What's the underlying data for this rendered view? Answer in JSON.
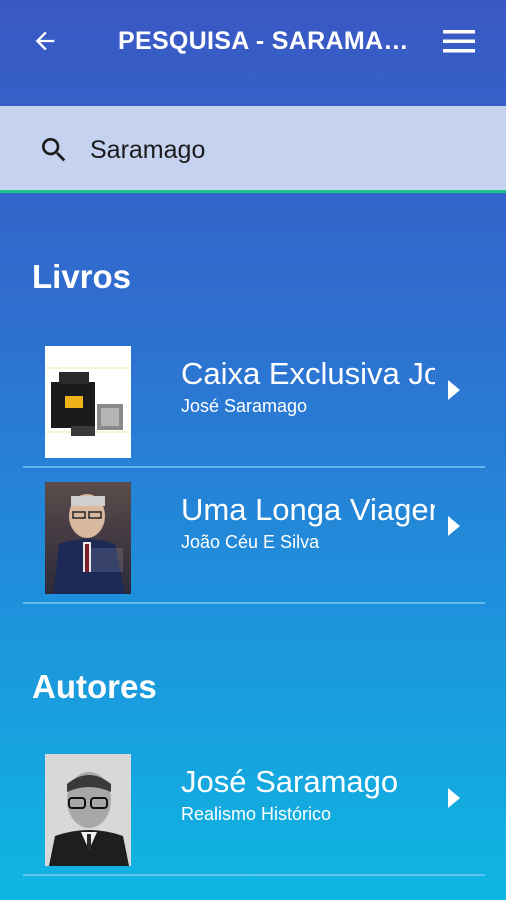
{
  "appbar": {
    "title": "PESQUISA - SARAMAGO",
    "back_icon": "arrow-back-icon",
    "menu_icon": "hamburger-menu-icon"
  },
  "search": {
    "value": "Saramago",
    "icon": "search-icon"
  },
  "sections": {
    "books": {
      "title": "Livros",
      "items": [
        {
          "title": "Caixa Exclusiva José Saramago",
          "subtitle": "José Saramago"
        },
        {
          "title": "Uma Longa Viagem com José Saramago",
          "subtitle": "João Céu E Silva"
        }
      ]
    },
    "authors": {
      "title": "Autores",
      "items": [
        {
          "title": "José Saramago",
          "subtitle": "Realismo Histórico"
        }
      ]
    }
  },
  "colors": {
    "appbar_top": "#3a58c4",
    "search_bg": "#c5d3f0",
    "search_underline": "#19c28a",
    "bottom_gradient": "#0fb6e2"
  }
}
